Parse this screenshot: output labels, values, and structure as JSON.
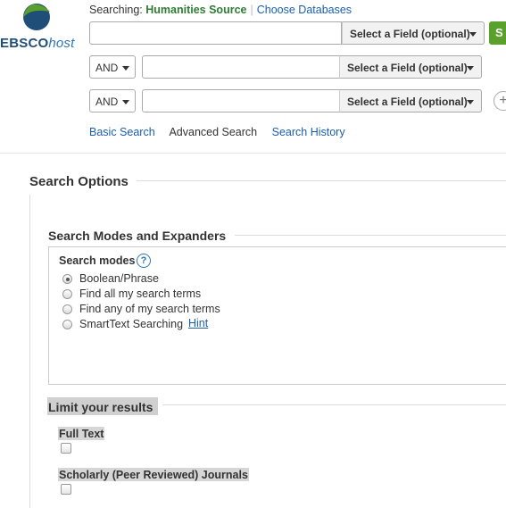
{
  "header": {
    "logo": {
      "brand": "EBSCO",
      "suffix": "host"
    },
    "searching_label": "Searching:",
    "database": "Humanities Source",
    "choose_databases": "Choose Databases",
    "go_label": "S",
    "field_placeholder": "Select a Field (optional)",
    "rows": [
      {
        "operator": "",
        "value": "",
        "field": "Select a Field (optional)"
      },
      {
        "operator": "AND",
        "value": "",
        "field": "Select a Field (optional)"
      },
      {
        "operator": "AND",
        "value": "",
        "field": "Select a Field (optional)"
      }
    ],
    "add_row": "+",
    "links": {
      "basic": "Basic Search",
      "advanced": "Advanced Search",
      "history": "Search History"
    }
  },
  "options": {
    "title": "Search Options",
    "modes_section": {
      "title": "Search Modes and Expanders",
      "label": "Search modes",
      "help": "?",
      "modes": [
        {
          "label": "Boolean/Phrase",
          "selected": true
        },
        {
          "label": "Find all my search terms",
          "selected": false
        },
        {
          "label": "Find any of my search terms",
          "selected": false
        },
        {
          "label": "SmartText Searching",
          "selected": false
        }
      ],
      "hint": "Hint"
    },
    "limits_section": {
      "title": "Limit your results",
      "full_text": "Full Text",
      "scholarly": "Scholarly (Peer Reviewed) Journals"
    }
  },
  "colors": {
    "accent_green": "#5aa02c",
    "link_blue": "#1a5fae",
    "db_green": "#2e7d32"
  }
}
